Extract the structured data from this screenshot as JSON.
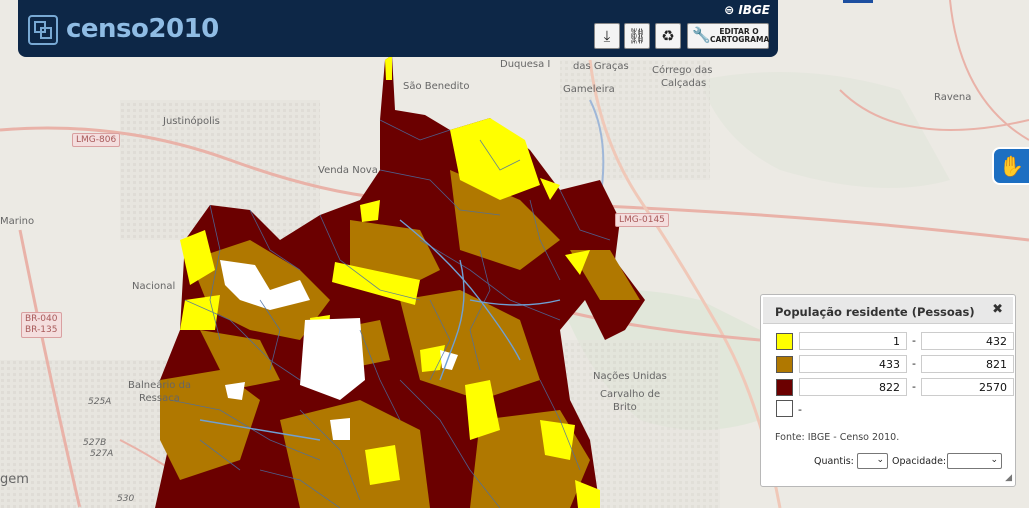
{
  "app": {
    "title": "censo2010",
    "brand": "IBGE"
  },
  "toolbar": {
    "download_icon": "download-icon",
    "link_icon": "link-icon",
    "recycle_icon": "recycle-icon",
    "edit_label_line1": "EDITAR O",
    "edit_label_line2": "CARTOGRAMA"
  },
  "map": {
    "place_labels": [
      "Duquesa I",
      "das Graças",
      "Córrego das",
      "Calçadas",
      "São Benedito",
      "Gameleira",
      "Justinópolis",
      "Venda Nova",
      "Ravena",
      "Marino",
      "Nacional",
      "Balneário da",
      "Ressaca",
      "Nações Unidas",
      "Carvalho de",
      "Brito",
      "gem"
    ],
    "road_labels": [
      "LMG-806",
      "BR-040",
      "BR-135",
      "LMG-0145"
    ],
    "number_labels": [
      "525A",
      "527B",
      "527A",
      "530"
    ]
  },
  "legend": {
    "title": "População residente (Pessoas)",
    "close_icon": "close-icon",
    "classes": [
      {
        "color": "#ffff00",
        "min": "1",
        "max": "432"
      },
      {
        "color": "#b07800",
        "min": "433",
        "max": "821"
      },
      {
        "color": "#6b0000",
        "min": "822",
        "max": "2570"
      }
    ],
    "no_data": {
      "color": "#ffffff",
      "label": "-"
    },
    "source": "Fonte: IBGE - Censo 2010.",
    "quantis_label": "Quantis:",
    "opacidade_label": "Opacidade:"
  },
  "colors": {
    "header_bg": "#0d2747",
    "accent": "#8fbce4",
    "class1": "#ffff00",
    "class2": "#b07800",
    "class3": "#6b0000",
    "boundary": "#4a6fa5"
  }
}
